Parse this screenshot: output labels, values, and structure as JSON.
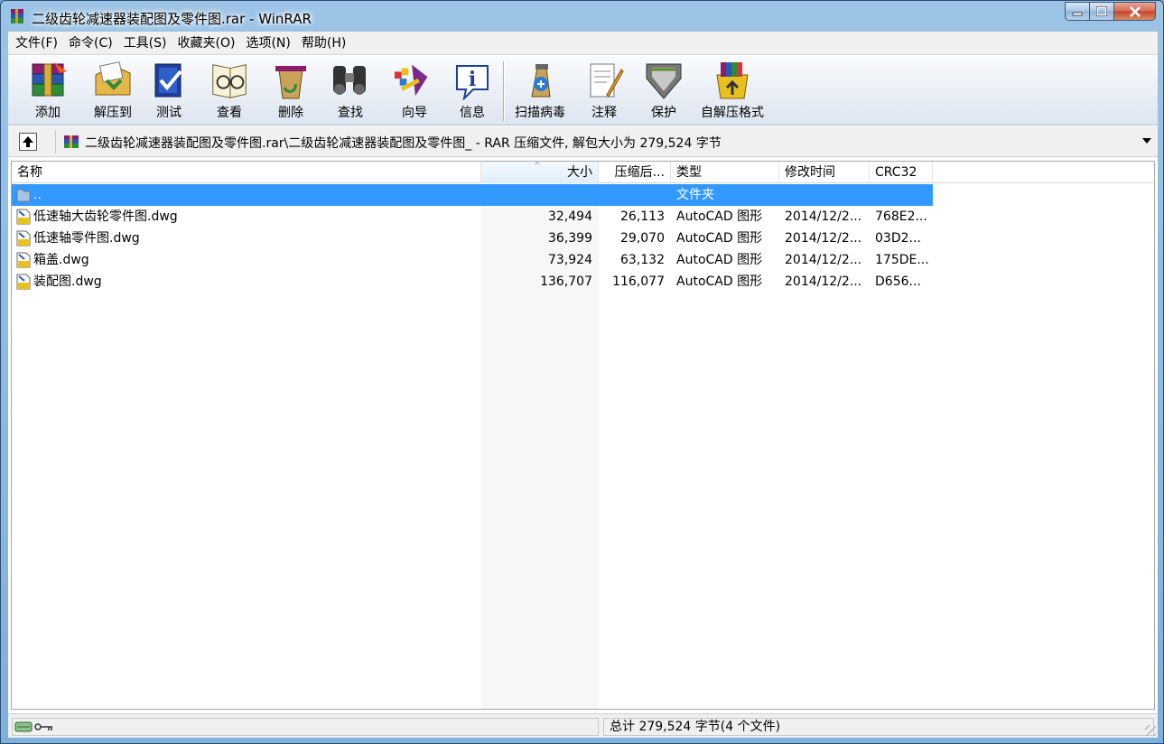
{
  "window": {
    "title": "二级齿轮减速器装配图及零件图.rar - WinRAR"
  },
  "menu": [
    "文件(F)",
    "命令(C)",
    "工具(S)",
    "收藏夹(O)",
    "选项(N)",
    "帮助(H)"
  ],
  "toolbar": [
    {
      "label": "添加",
      "icon": "add-archive-icon"
    },
    {
      "label": "解压到",
      "icon": "extract-to-icon"
    },
    {
      "label": "测试",
      "icon": "test-icon"
    },
    {
      "label": "查看",
      "icon": "view-icon"
    },
    {
      "label": "删除",
      "icon": "delete-icon"
    },
    {
      "label": "查找",
      "icon": "find-icon"
    },
    {
      "label": "向导",
      "icon": "wizard-icon"
    },
    {
      "label": "信息",
      "icon": "info-icon"
    },
    {
      "label": "扫描病毒",
      "icon": "virus-scan-icon"
    },
    {
      "label": "注释",
      "icon": "comment-icon"
    },
    {
      "label": "保护",
      "icon": "protect-icon"
    },
    {
      "label": "自解压格式",
      "icon": "sfx-icon"
    }
  ],
  "address": {
    "path": "二级齿轮减速器装配图及零件图.rar\\二级齿轮减速器装配图及零件图_ - RAR 压缩文件, 解包大小为 279,524 字节"
  },
  "columns": {
    "name": "名称",
    "size": "大小",
    "packed": "压缩后...",
    "type": "类型",
    "modified": "修改时间",
    "crc": "CRC32"
  },
  "rows": [
    {
      "name": "..",
      "size": "",
      "packed": "",
      "type": "文件夹",
      "modified": "",
      "crc": "",
      "icon": "folder-up-icon"
    },
    {
      "name": "低速轴大齿轮零件图.dwg",
      "size": "32,494",
      "packed": "26,113",
      "type": "AutoCAD 图形",
      "modified": "2014/12/2...",
      "crc": "768E2...",
      "icon": "dwg-file-icon"
    },
    {
      "name": "低速轴零件图.dwg",
      "size": "36,399",
      "packed": "29,070",
      "type": "AutoCAD 图形",
      "modified": "2014/12/2...",
      "crc": "03D2...",
      "icon": "dwg-file-icon"
    },
    {
      "name": "箱盖.dwg",
      "size": "73,924",
      "packed": "63,132",
      "type": "AutoCAD 图形",
      "modified": "2014/12/2...",
      "crc": "175DE...",
      "icon": "dwg-file-icon"
    },
    {
      "name": "装配图.dwg",
      "size": "136,707",
      "packed": "116,077",
      "type": "AutoCAD 图形",
      "modified": "2014/12/2...",
      "crc": "D656...",
      "icon": "dwg-file-icon"
    }
  ],
  "status": {
    "summary": "总计 279,524 字节(4 个文件)"
  }
}
